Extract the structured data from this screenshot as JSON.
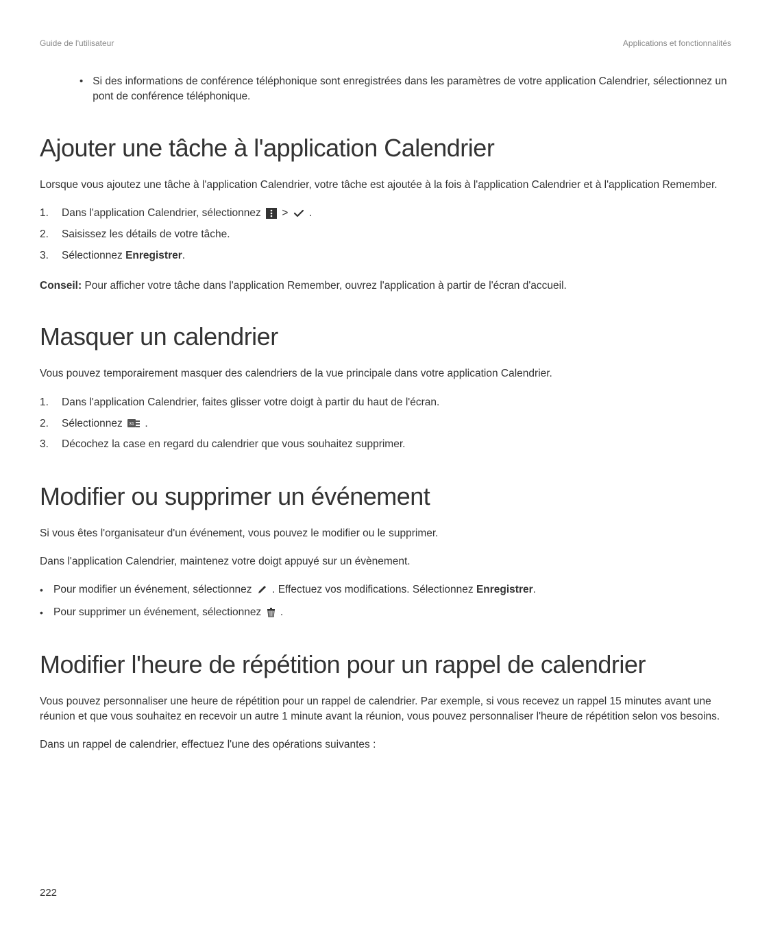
{
  "header": {
    "left": "Guide de l'utilisateur",
    "right": "Applications et fonctionnalités"
  },
  "intro_bullet": "Si des informations de conférence téléphonique sont enregistrées dans les paramètres de votre application Calendrier, sélectionnez un pont de conférence téléphonique.",
  "section1": {
    "title": "Ajouter une tâche à l'application Calendrier",
    "intro": "Lorsque vous ajoutez une tâche à l'application Calendrier, votre tâche est ajoutée à la fois à l'application Calendrier et à l'application Remember.",
    "steps": {
      "s1a": "Dans l'application Calendrier, sélectionnez ",
      "s1b": " > ",
      "s1c": " .",
      "s2": "Saisissez les détails de votre tâche.",
      "s3a": "Sélectionnez ",
      "s3b": "Enregistrer",
      "s3c": "."
    },
    "conseil_label": "Conseil:",
    "conseil_text": " Pour afficher votre tâche dans l'application Remember, ouvrez l'application à partir de l'écran d'accueil."
  },
  "section2": {
    "title": "Masquer un calendrier",
    "intro": "Vous pouvez temporairement masquer des calendriers de la vue principale dans votre application Calendrier.",
    "steps": {
      "s1": "Dans l'application Calendrier, faites glisser votre doigt à partir du haut de l'écran.",
      "s2a": "Sélectionnez ",
      "s2b": " .",
      "s3": "Décochez la case en regard du calendrier que vous souhaitez supprimer."
    }
  },
  "section3": {
    "title": "Modifier ou supprimer un événement",
    "p1": "Si vous êtes l'organisateur d'un événement, vous pouvez le modifier ou le supprimer.",
    "p2": "Dans l'application Calendrier, maintenez votre doigt appuyé sur un évènement.",
    "b1a": "Pour modifier un événement, sélectionnez  ",
    "b1b": " . Effectuez vos modifications. Sélectionnez ",
    "b1c": "Enregistrer",
    "b1d": ".",
    "b2a": "Pour supprimer un événement, sélectionnez  ",
    "b2b": " ."
  },
  "section4": {
    "title": "Modifier l'heure de répétition pour un rappel de calendrier",
    "p1": "Vous pouvez personnaliser une heure de répétition pour un rappel de calendrier. Par exemple, si vous recevez un rappel 15 minutes avant une réunion et que vous souhaitez en recevoir un autre 1 minute avant la réunion, vous pouvez personnaliser l'heure de répétition selon vos besoins.",
    "p2": "Dans un rappel de calendrier, effectuez l'une des opérations suivantes :"
  },
  "page_number": "222"
}
